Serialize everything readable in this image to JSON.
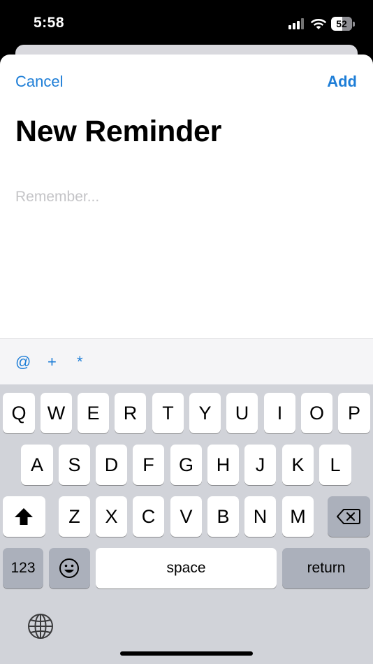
{
  "status_bar": {
    "time": "5:58",
    "battery_level": "52",
    "battery_fraction": 0.52
  },
  "nav": {
    "cancel_label": "Cancel",
    "add_label": "Add"
  },
  "title": "New Reminder",
  "reminder_input": {
    "placeholder": "Remember...",
    "value": ""
  },
  "accessory": {
    "mention": "@",
    "tag": "+",
    "flag": "*"
  },
  "keyboard": {
    "row1": [
      "Q",
      "W",
      "E",
      "R",
      "T",
      "Y",
      "U",
      "I",
      "O",
      "P"
    ],
    "row2": [
      "A",
      "S",
      "D",
      "F",
      "G",
      "H",
      "J",
      "K",
      "L"
    ],
    "row3": [
      "Z",
      "X",
      "C",
      "V",
      "B",
      "N",
      "M"
    ],
    "numbers_label": "123",
    "space_label": "space",
    "return_label": "return"
  },
  "icons": {
    "shift": "shift-icon",
    "delete": "delete-icon",
    "emoji": "emoji-icon",
    "globe": "globe-icon"
  },
  "colors": {
    "accent": "#1e7ed7",
    "keyboard_bg": "#d1d3d9",
    "key_dark": "#abb0bb"
  }
}
